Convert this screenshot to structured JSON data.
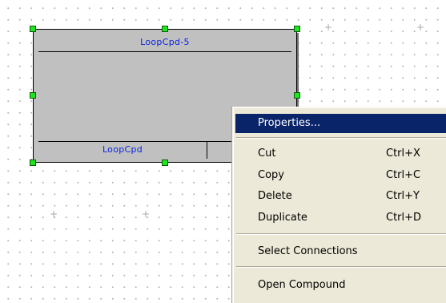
{
  "diagram": {
    "block": {
      "title": "LoopCpd-5",
      "footer_label": "LoopCpd",
      "selected": true
    },
    "grid_marker_icon": "plus-sign"
  },
  "context_menu": {
    "highlighted_item": "Properties...",
    "items": [
      {
        "label": "Properties...",
        "shortcut": ""
      },
      {
        "label": "Cut",
        "shortcut": "Ctrl+X"
      },
      {
        "label": "Copy",
        "shortcut": "Ctrl+C"
      },
      {
        "label": "Delete",
        "shortcut": "Ctrl+Y"
      },
      {
        "label": "Duplicate",
        "shortcut": "Ctrl+D"
      },
      {
        "label": "Select Connections",
        "shortcut": ""
      },
      {
        "label": "Open Compound",
        "shortcut": ""
      }
    ]
  },
  "colors": {
    "block_fill": "#c0c0c0",
    "block_text": "#0b24e0",
    "selection_handle": "#1ee61e",
    "menu_background": "#ece9d8",
    "menu_highlight": "#0a246a"
  }
}
